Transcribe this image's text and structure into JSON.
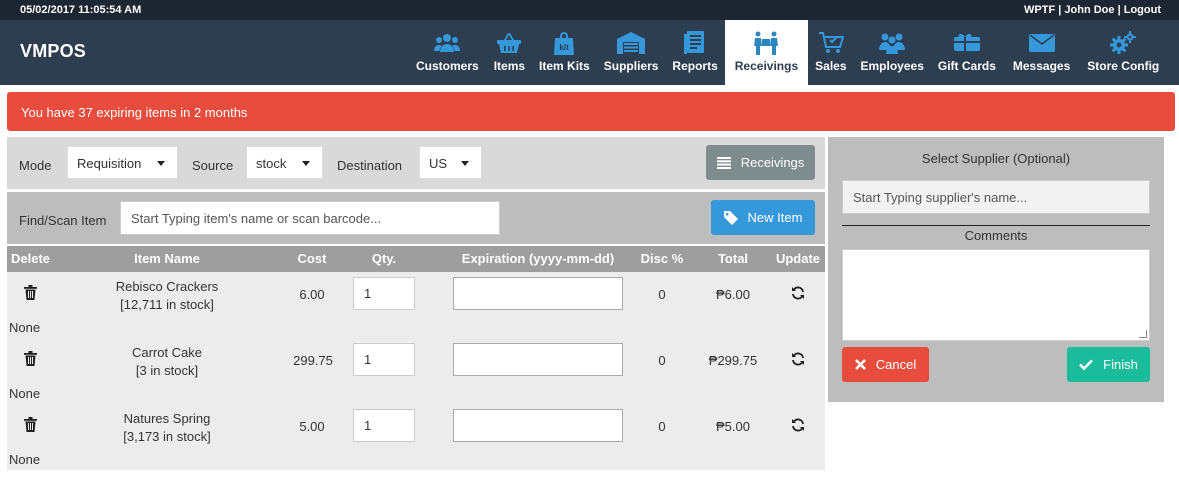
{
  "topbar": {
    "datetime": "05/02/2017 11:05:54 AM",
    "store": "WPTF",
    "user": "John Doe",
    "logout": "Logout",
    "sep": "|"
  },
  "brand": "VMPOS",
  "nav": [
    {
      "label": "Customers",
      "icon": "users-icon"
    },
    {
      "label": "Items",
      "icon": "basket-icon"
    },
    {
      "label": "Item Kits",
      "icon": "bag-icon"
    },
    {
      "label": "Suppliers",
      "icon": "warehouse-icon"
    },
    {
      "label": "Reports",
      "icon": "report-icon"
    },
    {
      "label": "Receivings",
      "icon": "receivings-icon",
      "active": true
    },
    {
      "label": "Sales",
      "icon": "cart-icon"
    },
    {
      "label": "Employees",
      "icon": "employees-icon"
    },
    {
      "label": "Gift Cards",
      "icon": "gift-card-icon"
    },
    {
      "label": "Messages",
      "icon": "envelope-icon"
    },
    {
      "label": "Store Config",
      "icon": "gears-icon"
    }
  ],
  "alert": "You have 37 expiring items in 2 months",
  "filters": {
    "mode_label": "Mode",
    "mode_value": "Requisition",
    "source_label": "Source",
    "source_value": "stock",
    "destination_label": "Destination",
    "destination_value": "US",
    "receivings_button": "Receivings"
  },
  "scan": {
    "label": "Find/Scan Item",
    "placeholder": "Start Typing item's name or scan barcode...",
    "new_item_button": "New Item"
  },
  "table": {
    "headers": [
      "Delete",
      "Item Name",
      "Cost",
      "Qty.",
      "Expiration (yyyy-mm-dd)",
      "Disc %",
      "Total",
      "Update"
    ],
    "rows": [
      {
        "name": "Rebisco Crackers",
        "stock": "[12,711 in stock]",
        "cost": "6.00",
        "qty": "1",
        "disc": "0",
        "total": "₱6.00",
        "note": "None"
      },
      {
        "name": "Carrot Cake",
        "stock": "[3 in stock]",
        "cost": "299.75",
        "qty": "1",
        "disc": "0",
        "total": "₱299.75",
        "note": "None"
      },
      {
        "name": "Natures Spring",
        "stock": "[3,173 in stock]",
        "cost": "5.00",
        "qty": "1",
        "disc": "0",
        "total": "₱5.00",
        "note": "None"
      }
    ]
  },
  "panel": {
    "title": "Select Supplier (Optional)",
    "supplier_placeholder": "Start Typing supplier's name...",
    "comments_label": "Comments",
    "cancel_button": "Cancel",
    "finish_button": "Finish"
  },
  "colors": {
    "topbar": "#1d2633",
    "navbar": "#2c3e50",
    "nav_icon": "#3498db",
    "alert": "#e74c3c",
    "receivings_button": "#7f8c8d",
    "new_item_button": "#3498db",
    "cancel_button": "#e74c3c",
    "finish_button": "#1abc9c"
  }
}
